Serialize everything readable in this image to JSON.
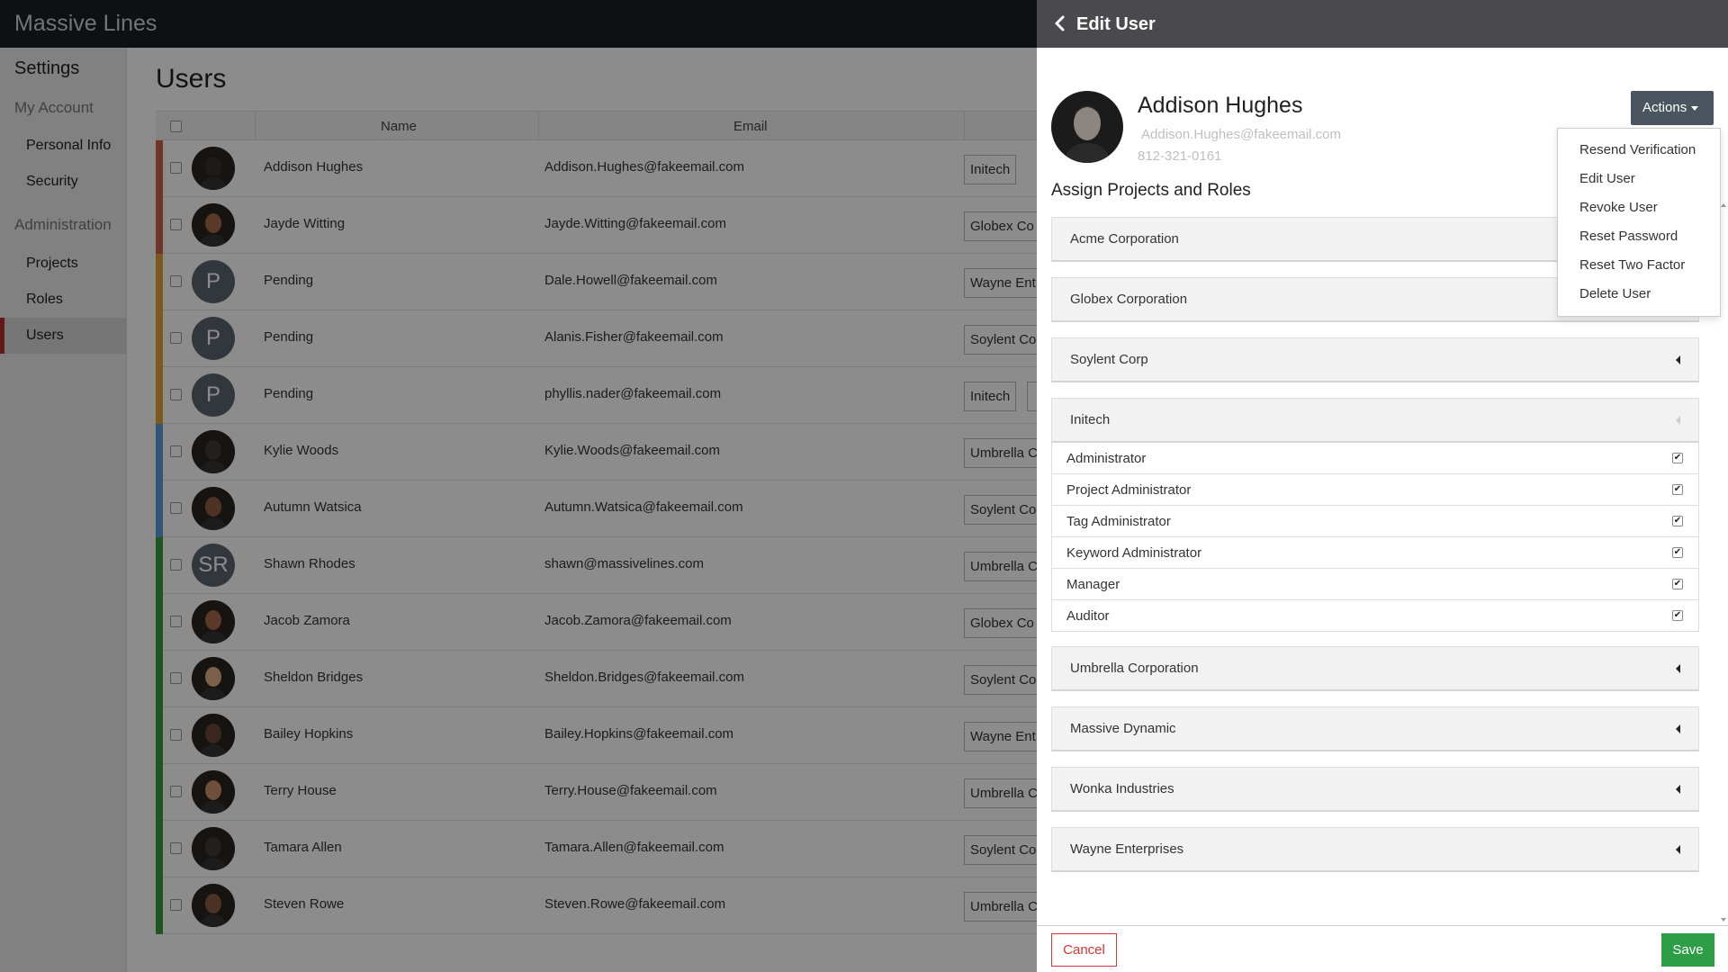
{
  "app": {
    "brand": "Massive Lines"
  },
  "sidebar": {
    "heading": "Settings",
    "sections": [
      {
        "label": "My Account",
        "items": [
          {
            "label": "Personal Info"
          },
          {
            "label": "Security"
          }
        ]
      },
      {
        "label": "Administration",
        "items": [
          {
            "label": "Projects"
          },
          {
            "label": "Roles"
          },
          {
            "label": "Users",
            "active": true
          }
        ]
      }
    ]
  },
  "users_page": {
    "title": "Users",
    "columns": {
      "name": "Name",
      "email": "Email"
    },
    "rows": [
      {
        "name": "Addison Hughes",
        "email": "Addison.Hughes@fakeemail.com",
        "tag": "Initech",
        "strip": "#d15d4a",
        "avatar": "photo"
      },
      {
        "name": "Jayde Witting",
        "email": "Jayde.Witting@fakeemail.com",
        "tag": "Globex Co",
        "strip": "#d15d4a",
        "avatar": "photo"
      },
      {
        "name": "Pending",
        "email": "Dale.Howell@fakeemail.com",
        "tag": "Wayne Ent",
        "strip": "#e0a23a",
        "avatar": "P"
      },
      {
        "name": "Pending",
        "email": "Alanis.Fisher@fakeemail.com",
        "tag": "Soylent Co",
        "strip": "#e0a23a",
        "avatar": "P"
      },
      {
        "name": "Pending",
        "email": "phyllis.nader@fakeemail.com",
        "tag": "Initech",
        "strip": "#e0a23a",
        "avatar": "P"
      },
      {
        "name": "Kylie Woods",
        "email": "Kylie.Woods@fakeemail.com",
        "tag": "Umbrella C",
        "strip": "#5b9bd5",
        "avatar": "photo"
      },
      {
        "name": "Autumn Watsica",
        "email": "Autumn.Watsica@fakeemail.com",
        "tag": "Soylent Co",
        "strip": "#5b9bd5",
        "avatar": "photo"
      },
      {
        "name": "Shawn Rhodes",
        "email": "shawn@massivelines.com",
        "tag": "Umbrella C",
        "strip": "#3c9a3c",
        "avatar": "SR"
      },
      {
        "name": "Jacob Zamora",
        "email": "Jacob.Zamora@fakeemail.com",
        "tag": "Globex Co",
        "strip": "#3c9a3c",
        "avatar": "photo"
      },
      {
        "name": "Sheldon Bridges",
        "email": "Sheldon.Bridges@fakeemail.com",
        "tag": "Soylent Co",
        "strip": "#3c9a3c",
        "avatar": "photo"
      },
      {
        "name": "Bailey Hopkins",
        "email": "Bailey.Hopkins@fakeemail.com",
        "tag": "Wayne Ent",
        "strip": "#3c9a3c",
        "avatar": "photo"
      },
      {
        "name": "Terry House",
        "email": "Terry.House@fakeemail.com",
        "tag": "Umbrella C",
        "strip": "#3c9a3c",
        "avatar": "photo"
      },
      {
        "name": "Tamara Allen",
        "email": "Tamara.Allen@fakeemail.com",
        "tag": "Soylent Co",
        "strip": "#3c9a3c",
        "avatar": "photo"
      },
      {
        "name": "Steven Rowe",
        "email": "Steven.Rowe@fakeemail.com",
        "tag": "Umbrella C",
        "strip": "#3c9a3c",
        "avatar": "photo"
      }
    ]
  },
  "drawer": {
    "title": "Edit User",
    "user": {
      "name": "Addison Hughes",
      "email": "Addison.Hughes@fakeemail.com",
      "phone": "812-321-0161"
    },
    "actions_label": "Actions",
    "actions_menu": [
      "Resend Verification",
      "Edit User",
      "Revoke User",
      "Reset Password",
      "Reset Two Factor",
      "Delete User"
    ],
    "section_title": "Assign Projects and Roles",
    "projects": [
      {
        "name": "Acme Corporation"
      },
      {
        "name": "Globex Corporation"
      },
      {
        "name": "Soylent Corp"
      },
      {
        "name": "Initech",
        "expanded": true
      },
      {
        "name": "Umbrella Corporation"
      },
      {
        "name": "Massive Dynamic"
      },
      {
        "name": "Wonka Industries"
      },
      {
        "name": "Wayne Enterprises"
      }
    ],
    "initech_roles": [
      {
        "label": "Administrator",
        "checked": true
      },
      {
        "label": "Project Administrator",
        "checked": true
      },
      {
        "label": "Tag Administrator",
        "checked": true
      },
      {
        "label": "Keyword Administrator",
        "checked": true
      },
      {
        "label": "Manager",
        "checked": true
      },
      {
        "label": "Auditor",
        "checked": true
      }
    ],
    "cancel_label": "Cancel",
    "save_label": "Save"
  },
  "colors": {
    "topbar": "#1a1f26",
    "drawer_header": "#4a4a4e",
    "save": "#2e9e46",
    "cancel": "#dd3333",
    "active_nav": "#b8282b"
  }
}
